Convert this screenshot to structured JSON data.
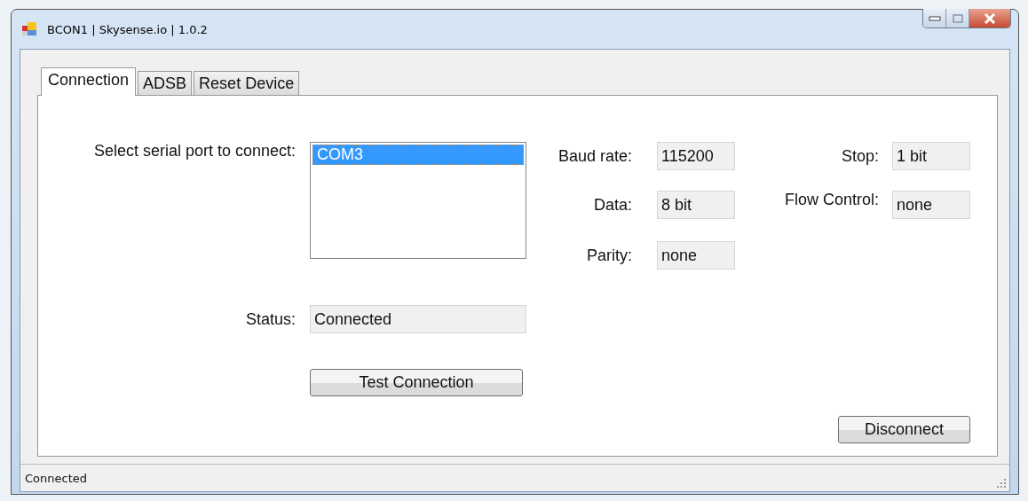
{
  "window": {
    "title": "BCON1 | Skysense.io | 1.0.2"
  },
  "tabs": [
    {
      "label": "Connection",
      "selected": true
    },
    {
      "label": "ADSB",
      "selected": false
    },
    {
      "label": "Reset Device",
      "selected": false
    }
  ],
  "port": {
    "label": "Select serial port to connect:",
    "items": [
      {
        "label": "COM3",
        "selected": true
      }
    ]
  },
  "settings_left": [
    {
      "label": "Baud rate:",
      "value": "115200"
    },
    {
      "label": "Data:",
      "value": "8 bit"
    },
    {
      "label": "Parity:",
      "value": "none"
    }
  ],
  "settings_right": [
    {
      "label": "Stop:",
      "value": "1 bit"
    },
    {
      "label": "Flow Control:",
      "value": "none"
    }
  ],
  "status": {
    "label": "Status:",
    "value": "Connected"
  },
  "buttons": [
    {
      "kind": "test",
      "label": "Test Connection"
    },
    {
      "kind": "disconnect",
      "label": "Disconnect"
    }
  ],
  "status_bar": "Connected"
}
